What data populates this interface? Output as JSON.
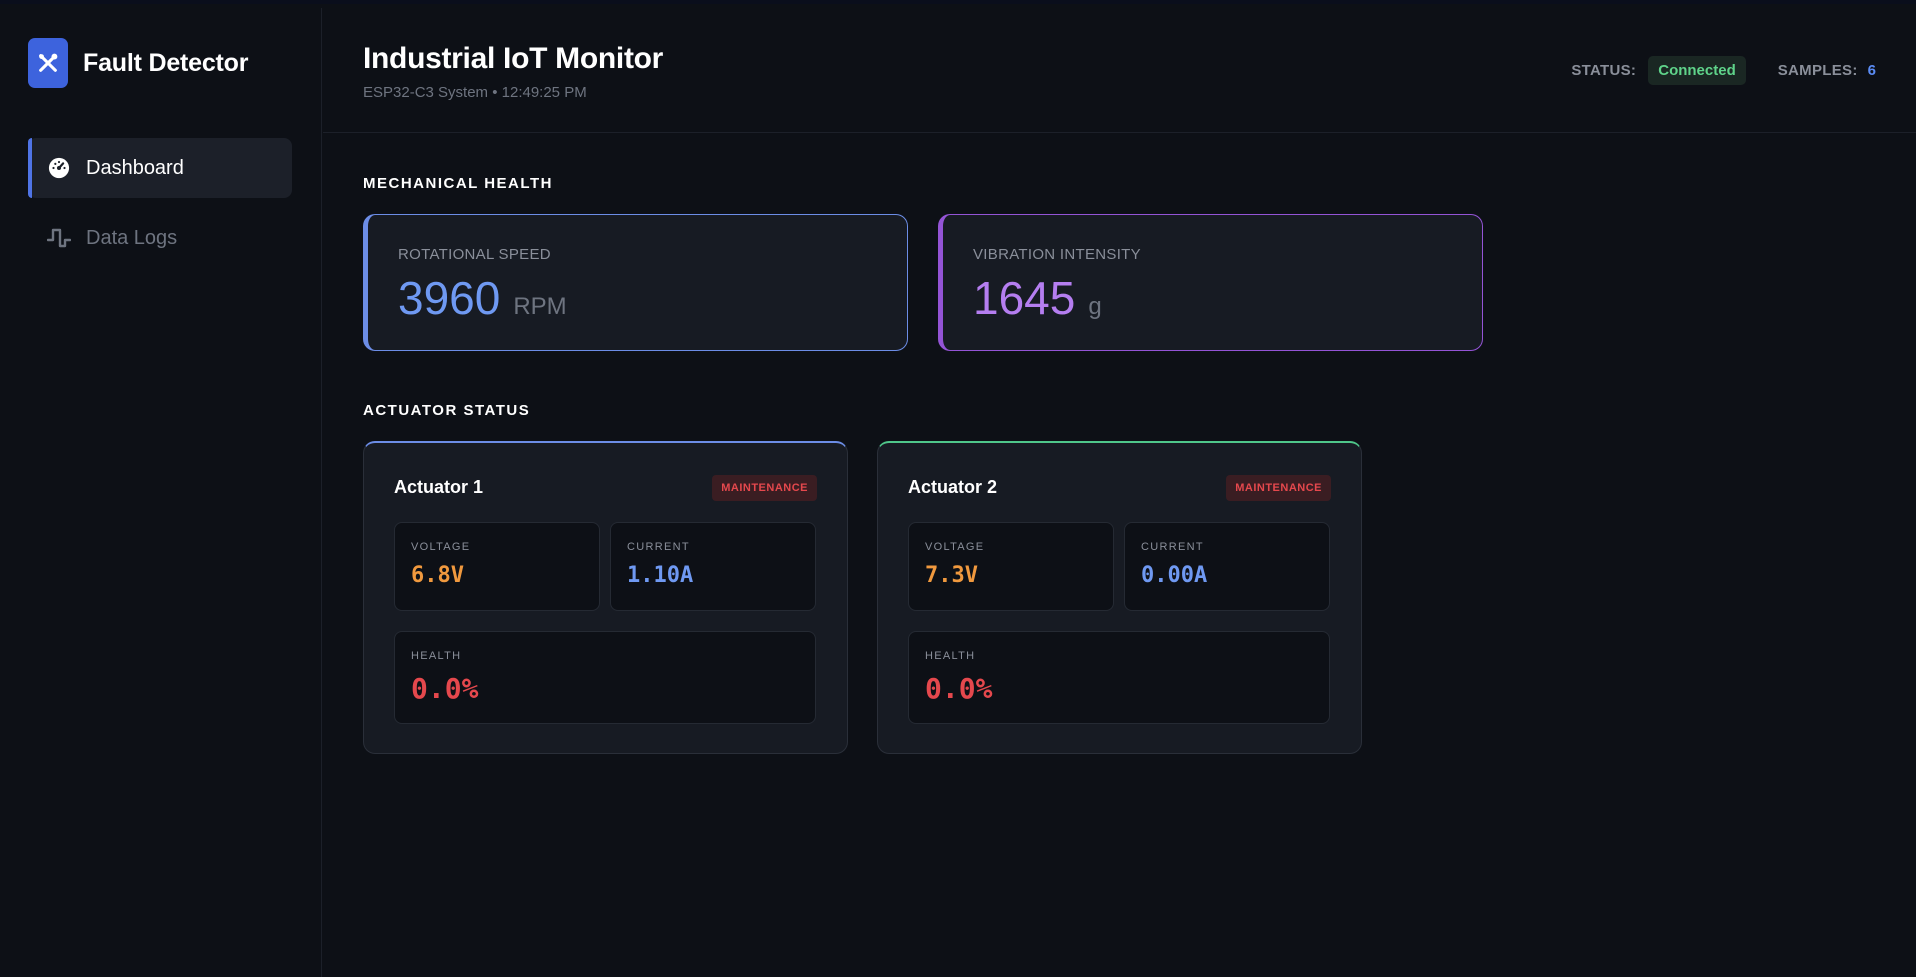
{
  "brand": {
    "name": "Fault Detector",
    "logo_icon": "tools-icon"
  },
  "sidebar": {
    "items": [
      {
        "label": "Dashboard",
        "icon": "gauge-icon",
        "active": true
      },
      {
        "label": "Data Logs",
        "icon": "pulse-icon",
        "active": false
      }
    ]
  },
  "header": {
    "title": "Industrial IoT Monitor",
    "subtitle": "ESP32-C3 System • 12:49:25 PM",
    "status_label": "STATUS:",
    "status_value": "Connected",
    "samples_label": "SAMPLES:",
    "samples_value": "6"
  },
  "mechanical": {
    "title": "MECHANICAL HEALTH",
    "speed": {
      "label": "ROTATIONAL SPEED",
      "value": "3960",
      "unit": "RPM"
    },
    "vibration": {
      "label": "VIBRATION INTENSITY",
      "value": "1645",
      "unit": "g"
    }
  },
  "actuators": {
    "title": "ACTUATOR STATUS",
    "items": [
      {
        "name": "Actuator 1",
        "badge": "MAINTENANCE",
        "voltage_label": "VOLTAGE",
        "voltage": "6.8V",
        "current_label": "CURRENT",
        "current": "1.10A",
        "health_label": "HEALTH",
        "health": "0.0%"
      },
      {
        "name": "Actuator 2",
        "badge": "MAINTENANCE",
        "voltage_label": "VOLTAGE",
        "voltage": "7.3V",
        "current_label": "CURRENT",
        "current": "0.00A",
        "health_label": "HEALTH",
        "health": "0.0%"
      }
    ]
  },
  "colors": {
    "accent_blue": "#3d63dd",
    "speed": "#6f99f2",
    "vibration": "#b57ef0",
    "voltage": "#f0993e",
    "health_bad": "#e5484d",
    "connected": "#5fd38a"
  }
}
